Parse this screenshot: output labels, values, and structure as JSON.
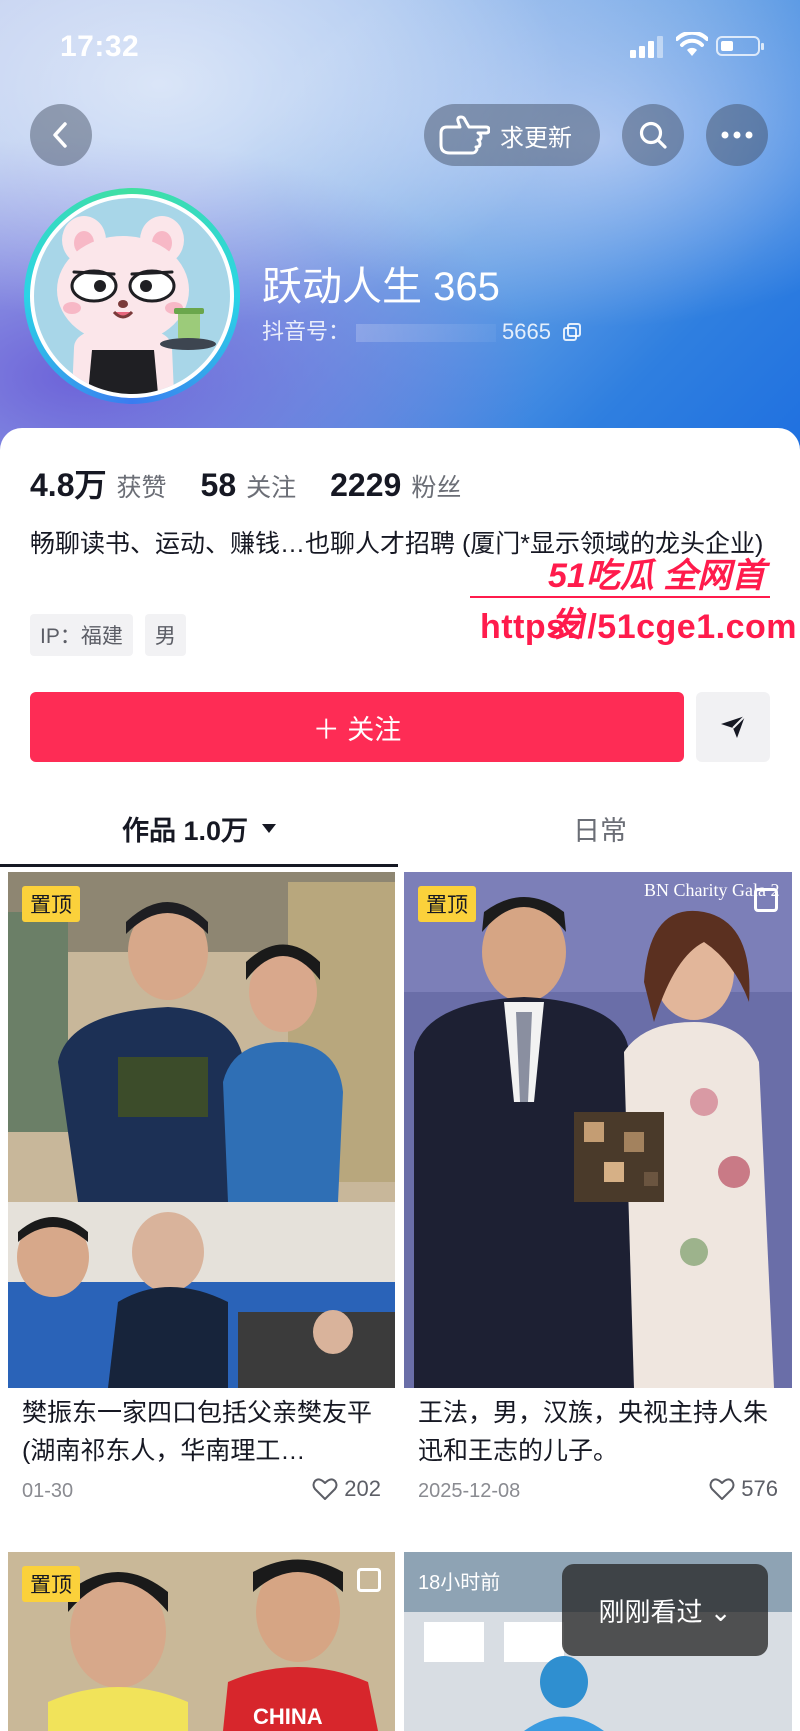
{
  "status": {
    "time": "17:32"
  },
  "header": {
    "update_label": "求更新"
  },
  "profile": {
    "nickname": "跃动人生 365",
    "douyin_id": "抖音号：",
    "douyin_id_tail": "5665",
    "stats": [
      {
        "num": "4.8万",
        "label": "获赞"
      },
      {
        "num": "58",
        "label": "关注"
      },
      {
        "num": "2229",
        "label": "粉丝"
      }
    ],
    "bio": "畅聊读书、运动、赚钱…也聊人才招聘 (厦门*显示领域的龙头企业)",
    "tags": [
      "IP：福建",
      "男"
    ],
    "follow_label": "＋ 关注"
  },
  "watermark": {
    "line1": "51吃瓜 全网首发",
    "line2": "https://51cge1.com"
  },
  "tabs": {
    "works": "作品 1.0万",
    "daily": "日常"
  },
  "posts": [
    {
      "pin": "置顶",
      "title": "樊振东一家四口包括父亲樊友平 (湖南祁东人，华南理工…",
      "date": "01-30",
      "likes": "202"
    },
    {
      "pin": "置顶",
      "title": "王法，男，汉族，央视主持人朱迅和王志的儿子。",
      "date": "2025-12-08",
      "likes": "576"
    },
    {
      "pin": "置顶"
    },
    {
      "badge": "18小时前"
    }
  ],
  "recent": {
    "label": "刚刚看过 ⌄"
  }
}
